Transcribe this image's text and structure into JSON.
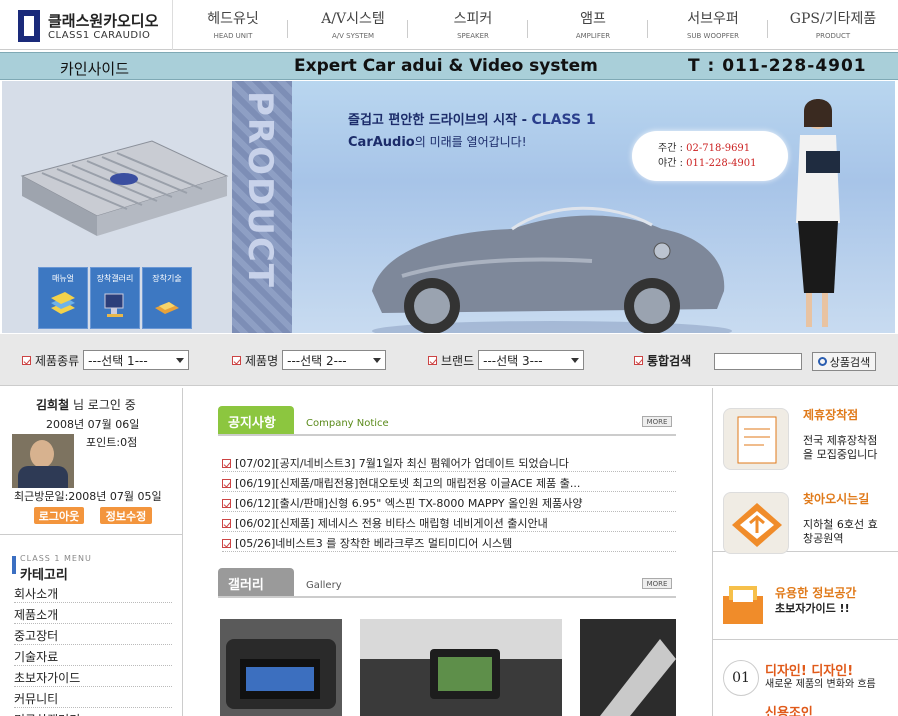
{
  "header": {
    "logo_ko": "클래스원카오디오",
    "logo_en": "CLASS1 CARAUDIO",
    "nav": [
      {
        "ko": "헤드유닛",
        "en": "HEAD UNIT"
      },
      {
        "ko": "A/V시스템",
        "en": "A/V SYSTEM"
      },
      {
        "ko": "스피커",
        "en": "SPEAKER"
      },
      {
        "ko": "앰프",
        "en": "AMPLIFER"
      },
      {
        "ko": "서브우퍼",
        "en": "SUB WOOPFER"
      },
      {
        "ko": "GPS/기타제품",
        "en": "PRODUCT"
      }
    ]
  },
  "titlebar": {
    "shop": "카인사이드",
    "slogan": "Expert Car adui & Video system",
    "tel": "T : 011-228-4901"
  },
  "banner": {
    "vertical_text": "PRODUCT",
    "icons": [
      "매뉴얼",
      "장착갤러리",
      "장착기술"
    ],
    "headline_pre": "즐겁고 편안한 드라이브의 시작 - ",
    "headline_brand": "CLASS 1",
    "subline_brand": "CarAudio",
    "subline_rest": "의 미래를 열어갑니다!",
    "day_label": "주간 : ",
    "day_phone": "02-718-9691",
    "night_label": "야간 : ",
    "night_phone": "011-228-4901"
  },
  "search": {
    "labels": [
      "제품종류",
      "제품명",
      "브랜드"
    ],
    "selects": [
      "---선택 1---",
      "---선택 2---",
      "---선택 3---"
    ],
    "total_label": "통합검색",
    "button": "상품검색"
  },
  "login": {
    "name": "김희철",
    "suffix": " 님 로그인 중",
    "date": "2008년 07월 06일",
    "points": "포인트:0점",
    "last_visit": "최근방문일:2008년 07월 05일",
    "logout": "로그아웃",
    "edit": "정보수정"
  },
  "category": {
    "sub": "CLASS 1 MENU",
    "title": "카테고리",
    "items": [
      "회사소개",
      "제품소개",
      "중고장터",
      "기술자료",
      "초보자가이드",
      "커뮤니티",
      "미국차갤러리"
    ]
  },
  "notice": {
    "tab": "공지사항",
    "sub": "Company Notice",
    "more": "MORE",
    "items": [
      "[07/02][공지/네비스트3] 7월1일자 최신 펌웨어가 업데이트 되었습니다",
      "[06/19][신제품/매립전용]현대오토넷 최고의 매립전용 이글ACE 제품 출...",
      "[06/12][출시/판매]신형 6.95\" 엑스핀 TX-8000 MAPPY 올인원 제품사양",
      "[06/02][신제품] 제네시스 전용 비타스 매립형 네비게이션 출시안내",
      "[05/26]네비스트3 를 장착한 베라크루즈 멀티미디어 시스템"
    ]
  },
  "gallery": {
    "tab": "갤러리",
    "sub": "Gallery",
    "more": "MORE"
  },
  "right": {
    "partner_title": "제휴장착점",
    "partner_desc": "전국 제휴장착점을 모집중입니다",
    "directions_title": "찾아오시는길",
    "directions_desc": "지하철 6호선 효창공원역",
    "info_title": "유용한 정보공간",
    "info_desc": "초보자가이드 !!",
    "design_num": "01",
    "design_title": "디자인! 디자인!",
    "design_desc": "새로운 제품의 변화와 흐름",
    "new_title": "신용조인"
  },
  "colors": {
    "titlebar": "#a9cfd9",
    "notice_tab": "#8cc63f",
    "gallery_tab": "#9a9a9a",
    "accent_orange": "#e07a1a"
  }
}
